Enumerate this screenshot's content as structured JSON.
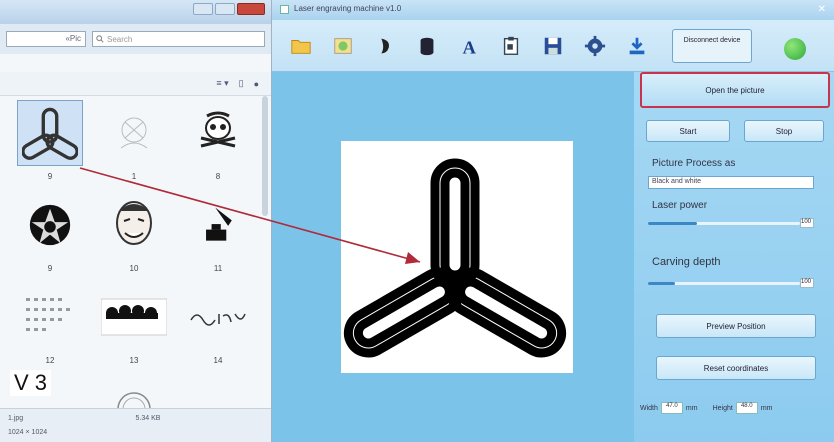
{
  "explorer": {
    "address_text": "«Pic",
    "search_placeholder": "Search",
    "toolbar_view": "≡ ▾",
    "files": [
      {
        "name": "tri-link-logo",
        "caption": "9",
        "selected": true
      },
      {
        "name": "sketch",
        "caption": "1",
        "selected": false
      },
      {
        "name": "skull",
        "caption": "8",
        "selected": false
      },
      {
        "name": "emblem",
        "caption": "9",
        "selected": false
      },
      {
        "name": "face",
        "caption": "10",
        "selected": false
      },
      {
        "name": "phonograph",
        "caption": "11",
        "selected": false
      },
      {
        "name": "calendar",
        "caption": "12",
        "selected": false
      },
      {
        "name": "clouds",
        "caption": "13",
        "selected": false
      },
      {
        "name": "text-sign",
        "caption": "14",
        "selected": false
      },
      {
        "name": "blank-1",
        "caption": "",
        "selected": false
      },
      {
        "name": "stamp",
        "caption": "",
        "selected": false
      }
    ],
    "overlay_label": "V 3",
    "status": {
      "left_top": "1.jpg",
      "right_top": "5.34 KB",
      "left_bottom": "1024 × 1024",
      "right_bottom": ""
    }
  },
  "app": {
    "title": "Laser engraving machine v1.0",
    "toolbar": {
      "connect_label": "Disconnect device",
      "status_color": "#2ea83a"
    },
    "panel": {
      "open_button": "Open the picture",
      "start_button": "Start",
      "stop_button": "Stop",
      "process_label": "Picture Process as",
      "process_value": "Black and white",
      "power_label": "Laser power",
      "power_level": 0.32,
      "power_value": "100",
      "depth_label": "Carving depth",
      "depth_level": 0.18,
      "depth_value": "100",
      "preview_button": "Preview Position",
      "reset_button": "Reset coordinates",
      "width_label": "Width",
      "width_value": "47.0",
      "width_unit": "mm",
      "height_label": "Height",
      "height_value": "48.0",
      "height_unit": "mm"
    }
  }
}
